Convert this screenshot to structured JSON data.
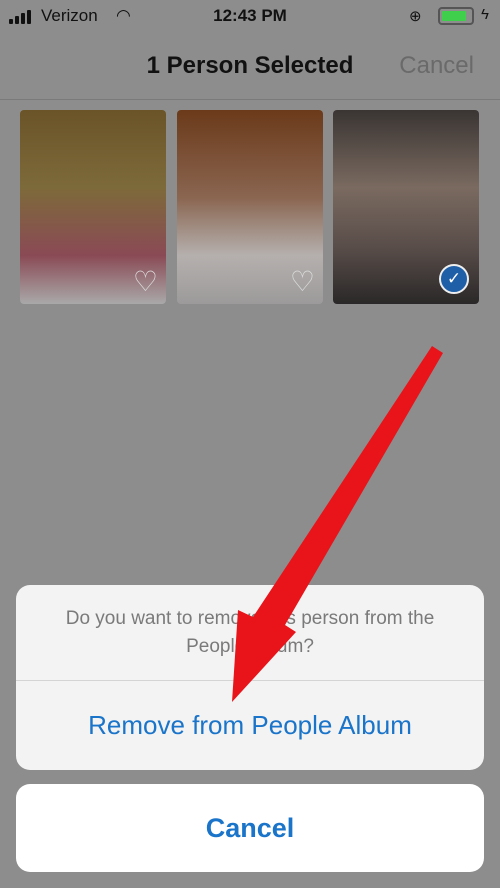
{
  "status_bar": {
    "carrier": "Verizon",
    "time": "12:43 PM",
    "battery_level": 0.85,
    "battery_color": "#3fcf4c",
    "icons": [
      "signal-icon",
      "wifi-icon",
      "rotation-lock-icon",
      "battery-icon",
      "charging-icon"
    ]
  },
  "nav": {
    "title": "1 Person Selected",
    "cancel_label": "Cancel"
  },
  "photos": [
    {
      "selected": false,
      "icon": "heart-icon"
    },
    {
      "selected": false,
      "icon": "heart-icon"
    },
    {
      "selected": true,
      "icon": "checkmark-icon"
    }
  ],
  "action_sheet": {
    "message": "Do you want to remove this person from the People Album?",
    "remove_label": "Remove from People Album",
    "cancel_label": "Cancel",
    "accent": "#1a74c9"
  },
  "annotation": {
    "arrow_color": "#e8141a"
  }
}
